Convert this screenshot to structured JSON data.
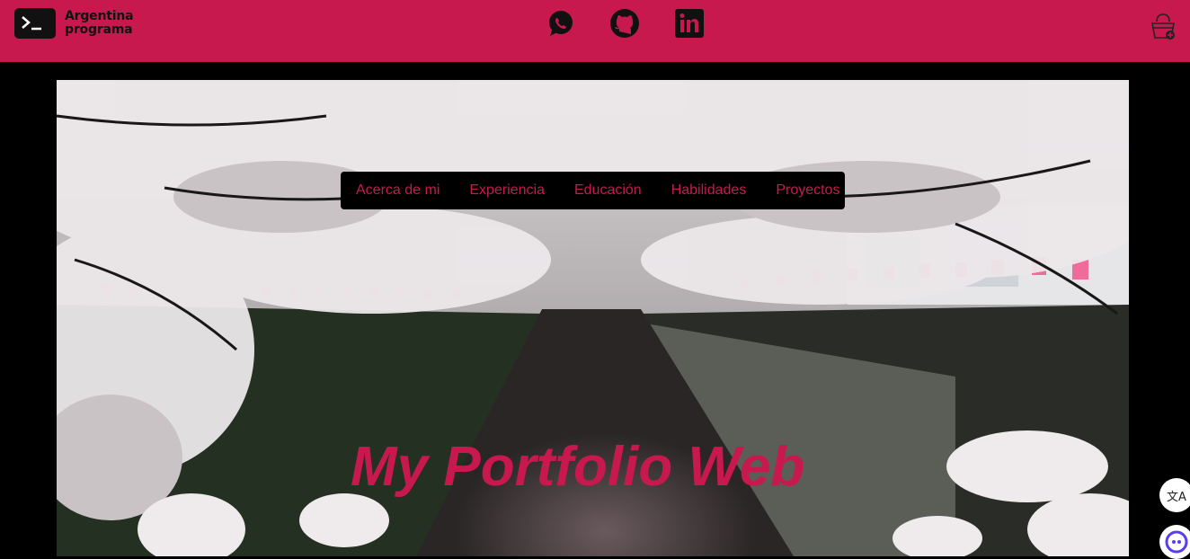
{
  "header": {
    "brand_line1": "Argentina",
    "brand_line2": "programa",
    "accent_color": "#c8194f"
  },
  "social": [
    {
      "icon": "whatsapp-icon"
    },
    {
      "icon": "github-icon"
    },
    {
      "icon": "linkedin-icon"
    }
  ],
  "cart": {
    "icon": "basket-add-icon"
  },
  "nav": {
    "items": [
      "Acerca de mi",
      "Experiencia",
      "Educación",
      "Habilidades",
      "Proyectos"
    ]
  },
  "hero": {
    "title": "My Portfolio Web",
    "background": "cherry-blossom-canal-photo"
  },
  "floating": {
    "translate_icon": "translate-icon",
    "translate_glyph": "文A",
    "assistant_icon": "assistant-icon"
  }
}
